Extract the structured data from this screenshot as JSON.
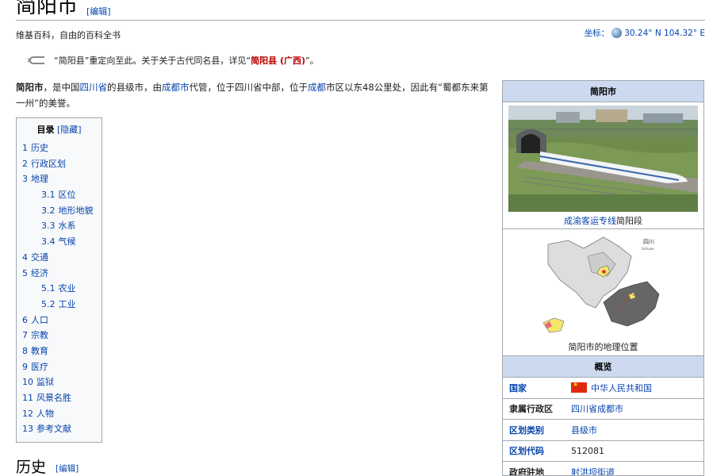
{
  "header": {
    "title": "简阳市",
    "edit_link": "[编辑]",
    "tagline": "维基百科，自由的百科全书",
    "coords_label": "坐标：",
    "coords_value": "30.24° N 104.32° E"
  },
  "hatnote": {
    "part1": "“简阳县”重定向至此。关于关于古代同名县，详见“",
    "link": "简阳县 (广西)",
    "part2": "”。"
  },
  "lead": {
    "bold": "简阳市",
    "t1": "，是中国",
    "l1": "四川省",
    "t2": "的县级市，由",
    "l2": "成都市",
    "t3": "代管，位于四川省中部，位于",
    "l3": "成都",
    "t4": "市区以东48公里处，因此有“蜀都东来第一州”的美誉。"
  },
  "toc": {
    "title": "目录",
    "toggle": "[隐藏]",
    "items": [
      {
        "num": "1",
        "label": "历史",
        "level": 1
      },
      {
        "num": "2",
        "label": "行政区划",
        "level": 1
      },
      {
        "num": "3",
        "label": "地理",
        "level": 1
      },
      {
        "num": "3.1",
        "label": "区位",
        "level": 2
      },
      {
        "num": "3.2",
        "label": "地形地貌",
        "level": 2
      },
      {
        "num": "3.3",
        "label": "水系",
        "level": 2
      },
      {
        "num": "3.4",
        "label": "气候",
        "level": 2
      },
      {
        "num": "4",
        "label": "交通",
        "level": 1
      },
      {
        "num": "5",
        "label": "经济",
        "level": 1
      },
      {
        "num": "5.1",
        "label": "农业",
        "level": 2
      },
      {
        "num": "5.2",
        "label": "工业",
        "level": 2
      },
      {
        "num": "6",
        "label": "人口",
        "level": 1
      },
      {
        "num": "7",
        "label": "宗教",
        "level": 1
      },
      {
        "num": "8",
        "label": "教育",
        "level": 1
      },
      {
        "num": "9",
        "label": "医疗",
        "level": 1
      },
      {
        "num": "10",
        "label": "监狱",
        "level": 1
      },
      {
        "num": "11",
        "label": "风景名胜",
        "level": 1
      },
      {
        "num": "12",
        "label": "人物",
        "level": 1
      },
      {
        "num": "13",
        "label": "参考文献",
        "level": 1
      }
    ]
  },
  "section": {
    "heading": "历史",
    "edit_link": "[编辑]"
  },
  "infobox": {
    "title": "简阳市",
    "photo_caption_link": "成渝客运专线",
    "photo_caption_text": "简阳段",
    "map_label": "四川",
    "map_sublabel": "Sichuan",
    "map_caption": "简阳市的地理位置",
    "overview": "概览",
    "rows": [
      {
        "label": "国家",
        "value": "中华人民共和国",
        "label_link": true,
        "value_link": true,
        "flag": true
      },
      {
        "label": "隶属行政区",
        "value": "四川省成都市",
        "label_link": false,
        "value_link": true,
        "flag": false
      },
      {
        "label": "区划类别",
        "value": "县级市",
        "label_link": true,
        "value_link": true,
        "flag": false
      },
      {
        "label": "区划代码",
        "value": "512081",
        "label_link": true,
        "value_link": false,
        "flag": false
      },
      {
        "label": "政府驻地",
        "value": "射洪坝街道",
        "label_link": false,
        "value_link": true,
        "flag": false
      }
    ]
  },
  "colors": {
    "link": "#0645ad",
    "redlink": "#ba0000",
    "infobox_header": "#ccd9ef",
    "border": "#a2a9b1"
  }
}
